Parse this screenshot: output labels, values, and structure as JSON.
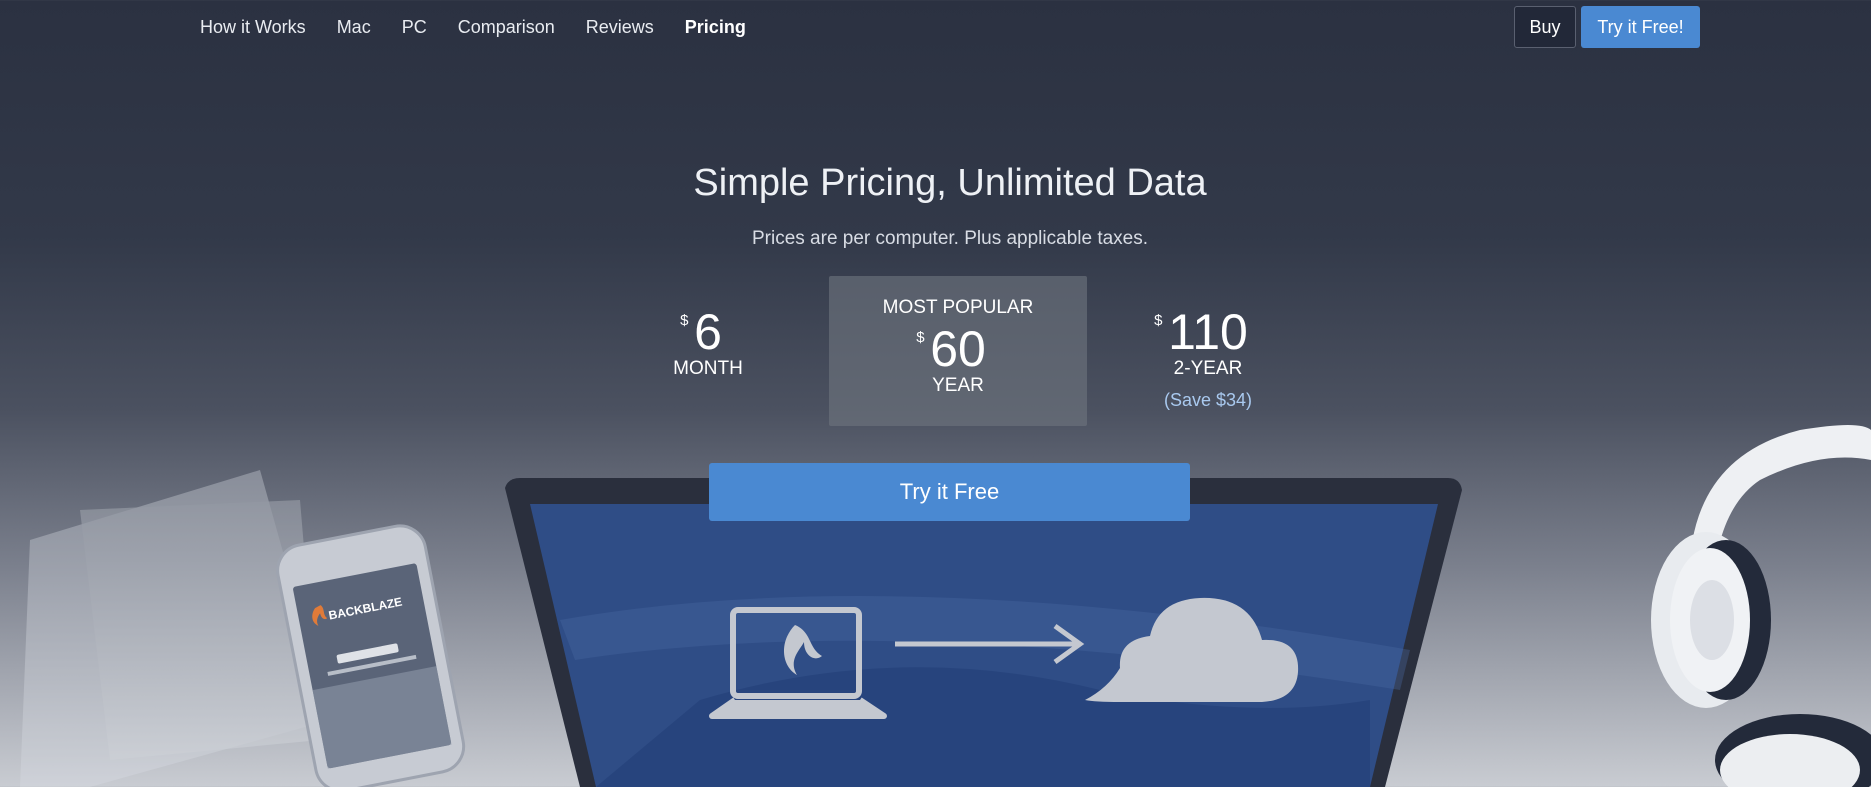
{
  "nav": {
    "links": [
      {
        "label": "How it Works"
      },
      {
        "label": "Mac"
      },
      {
        "label": "PC"
      },
      {
        "label": "Comparison"
      },
      {
        "label": "Reviews"
      },
      {
        "label": "Pricing",
        "active": true
      }
    ],
    "buy_label": "Buy",
    "try_label": "Try it Free!"
  },
  "hero": {
    "title": "Simple Pricing, Unlimited Data",
    "subtitle": "Prices are per computer. Plus applicable taxes."
  },
  "plans": [
    {
      "currency": "$",
      "amount": "6",
      "period": "MONTH"
    },
    {
      "badge": "MOST POPULAR",
      "currency": "$",
      "amount": "60",
      "period": "YEAR"
    },
    {
      "currency": "$",
      "amount": "110",
      "period": "2-YEAR",
      "note": "(Save $34)"
    }
  ],
  "cta": {
    "label": "Try it Free"
  },
  "phone": {
    "brand": "BACKBLAZE"
  },
  "colors": {
    "accent": "#4a89d2",
    "nav_bg": "#2b3141",
    "highlight_card": "#6e747e",
    "save_text": "#a9c9ef"
  },
  "icons": [
    "laptop-icon",
    "flame-logo-icon",
    "arrow-right-icon",
    "cloud-icon",
    "phone-device",
    "headphones-device"
  ]
}
